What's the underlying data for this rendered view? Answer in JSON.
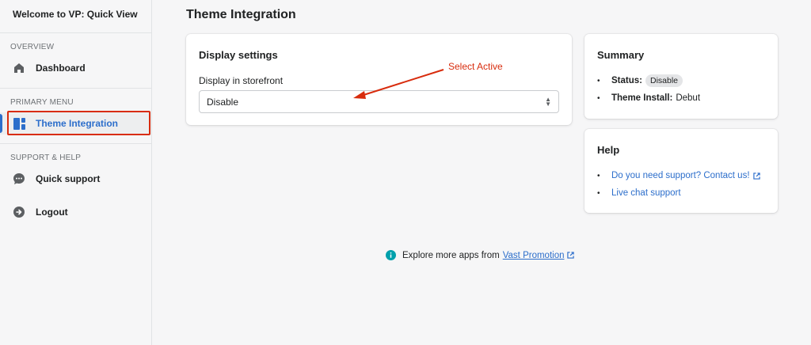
{
  "app": {
    "title": "Welcome to VP: Quick View"
  },
  "sidebar": {
    "overview_title": "OVERVIEW",
    "primary_title": "PRIMARY MENU",
    "support_title": "SUPPORT & HELP",
    "items": {
      "dashboard": "Dashboard",
      "theme_integration": "Theme Integration",
      "quick_support": "Quick support",
      "logout": "Logout"
    }
  },
  "page": {
    "title": "Theme Integration"
  },
  "display_settings": {
    "title": "Display settings",
    "field_label": "Display in storefront",
    "selected_value": "Disable"
  },
  "annotation": {
    "text": "Select Active",
    "color": "#d82c0d"
  },
  "summary": {
    "title": "Summary",
    "status_label": "Status:",
    "status_value": "Disable",
    "theme_label": "Theme Install:",
    "theme_value": "Debut"
  },
  "help": {
    "title": "Help",
    "link1": "Do you need support? Contact us!",
    "link2": "Live chat support"
  },
  "footer": {
    "text": "Explore more apps from",
    "link": "Vast Promotion"
  },
  "colors": {
    "accent": "#2c6ecb",
    "info": "#00a0ac",
    "annotation": "#d82c0d"
  }
}
